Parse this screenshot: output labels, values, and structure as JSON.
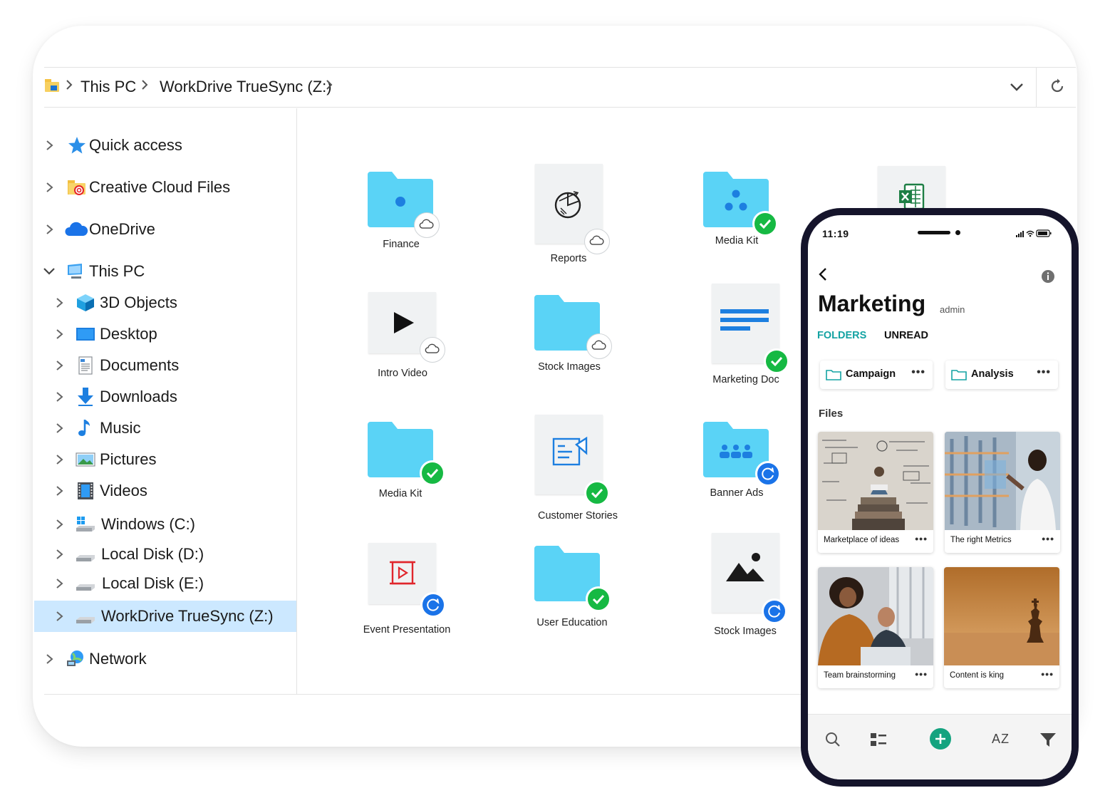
{
  "explorer": {
    "breadcrumb": [
      "This PC",
      "WorkDrive TrueSync (Z:)"
    ],
    "sidebar": [
      {
        "label": "Quick access",
        "icon": "star-icon"
      },
      {
        "label": "Creative Cloud Files",
        "icon": "creative-cloud-folder-icon"
      },
      {
        "label": "OneDrive",
        "icon": "onedrive-cloud-icon"
      },
      {
        "label": "This PC",
        "icon": "computer-icon",
        "expanded": true
      },
      {
        "label": "3D Objects",
        "icon": "cube-icon"
      },
      {
        "label": "Desktop",
        "icon": "desktop-icon"
      },
      {
        "label": "Documents",
        "icon": "documents-icon"
      },
      {
        "label": "Downloads",
        "icon": "download-arrow-icon"
      },
      {
        "label": "Music",
        "icon": "music-note-icon"
      },
      {
        "label": "Pictures",
        "icon": "pictures-icon"
      },
      {
        "label": "Videos",
        "icon": "film-icon"
      },
      {
        "label": "Windows (C:)",
        "icon": "windows-drive-icon"
      },
      {
        "label": "Local Disk (D:)",
        "icon": "disk-drive-icon"
      },
      {
        "label": "Local Disk (E:)",
        "icon": "disk-drive-icon"
      },
      {
        "label": "WorkDrive TrueSync (Z:)",
        "icon": "disk-drive-icon",
        "selected": true
      },
      {
        "label": "Network",
        "icon": "network-icon"
      }
    ],
    "files": [
      {
        "name": "Finance",
        "kind": "folder",
        "status": "cloud"
      },
      {
        "name": "Reports",
        "kind": "doc",
        "status": "cloud"
      },
      {
        "name": "Media Kit",
        "kind": "folder",
        "status": "synced"
      },
      {
        "name": "Intro Video",
        "kind": "doc",
        "status": "cloud"
      },
      {
        "name": "Stock Images",
        "kind": "folder",
        "status": "cloud"
      },
      {
        "name": "Marketing Doc",
        "kind": "doc",
        "status": "synced"
      },
      {
        "name": "Media Kit",
        "kind": "folder",
        "status": "synced"
      },
      {
        "name": "Customer Stories",
        "kind": "doc",
        "status": "synced"
      },
      {
        "name": "Banner Ads",
        "kind": "folder",
        "status": "syncing"
      },
      {
        "name": "Event Presentation",
        "kind": "doc",
        "status": "syncing"
      },
      {
        "name": "User Education",
        "kind": "folder",
        "status": "synced"
      },
      {
        "name": "Stock Images",
        "kind": "doc",
        "status": "syncing"
      }
    ]
  },
  "phone": {
    "time": "11:19",
    "title": "Marketing",
    "role": "admin",
    "tabs": [
      "FOLDERS",
      "UNREAD"
    ],
    "folders": [
      "Campaign",
      "Analysis"
    ],
    "more_label": "•••",
    "files_heading": "Files",
    "files": [
      "Marketplace of ideas",
      "The right Metrics",
      "Team brainstorming",
      "Content is king"
    ],
    "sort_label": "AZ"
  },
  "colors": {
    "folder": "#5ad3f6",
    "synced": "#16b943",
    "syncing": "#1a73e8",
    "accent": "#14a3a3",
    "selection": "#cce8ff"
  }
}
